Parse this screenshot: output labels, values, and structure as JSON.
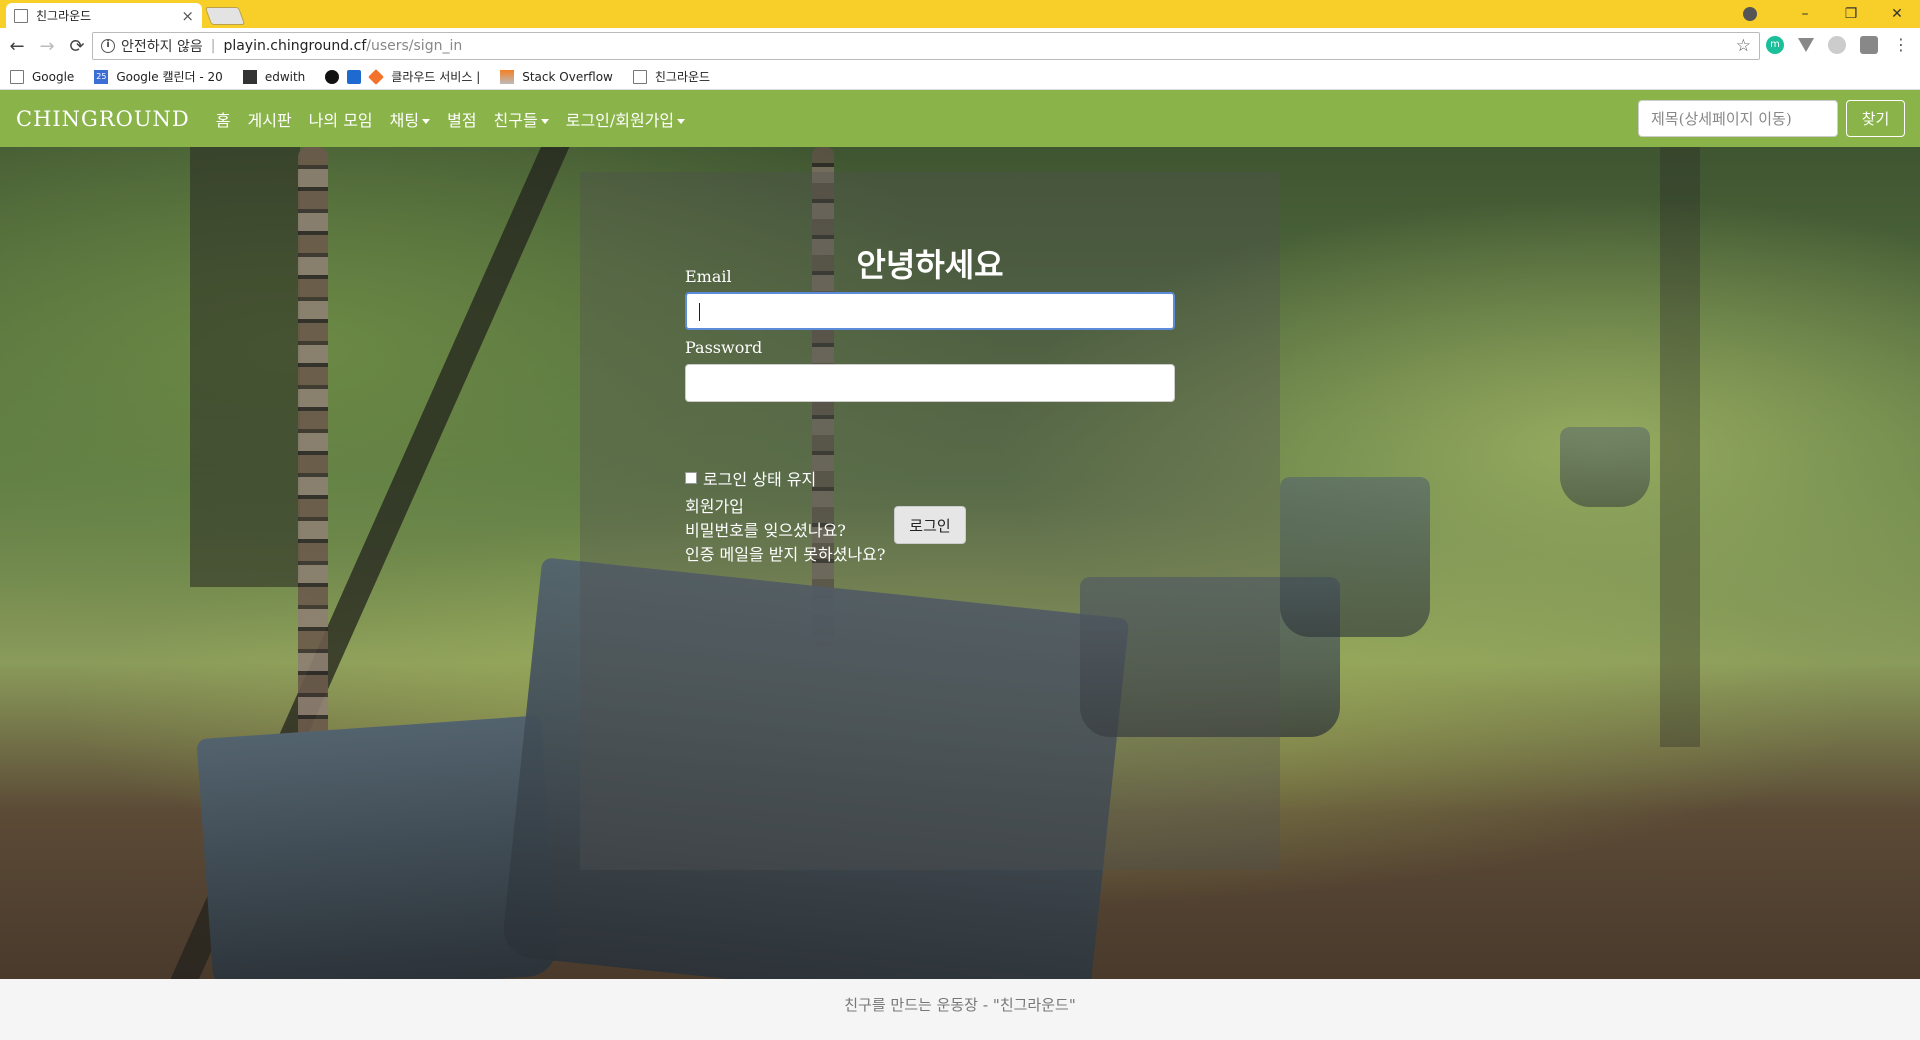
{
  "browser": {
    "tab_title": "친그라운드",
    "tab_close": "×",
    "window_controls": [
      "–",
      "❐",
      "✕"
    ],
    "nav": {
      "back": "←",
      "forward": "→",
      "reload": "⟳"
    },
    "address": {
      "security_label": "안전하지 않음",
      "host": "playin.chinground.cf",
      "path": "/users/sign_in"
    },
    "bookmark_star": "☆",
    "bookmarks": [
      {
        "label": "Google",
        "icon": "page-icon"
      },
      {
        "label": "Google 캘린더 - 20",
        "icon": "calendar-icon",
        "badge": "25"
      },
      {
        "label": "edwith",
        "icon": "edwith-icon"
      },
      {
        "label": "",
        "icon": "github-icon"
      },
      {
        "label": "",
        "icon": "blue-square-icon"
      },
      {
        "label": "클라우드 서비스 | ",
        "icon": "cube-icon"
      },
      {
        "label": "Stack Overflow",
        "icon": "stackoverflow-icon"
      },
      {
        "label": "친그라운드",
        "icon": "page-icon"
      }
    ],
    "extensions": [
      "m",
      "",
      "",
      "",
      "⋮"
    ]
  },
  "navbar": {
    "brand": "CHINGROUND",
    "items": [
      {
        "label": "홈",
        "dropdown": false
      },
      {
        "label": "게시판",
        "dropdown": false
      },
      {
        "label": "나의 모임",
        "dropdown": false
      },
      {
        "label": "채팅",
        "dropdown": true
      },
      {
        "label": "별점",
        "dropdown": false
      },
      {
        "label": "친구들",
        "dropdown": true
      },
      {
        "label": "로그인/회원가입",
        "dropdown": true
      }
    ],
    "search_placeholder": "제목(상세페이지 이동)",
    "search_button": "찾기",
    "color": "#8ab44a"
  },
  "login": {
    "greeting": "안녕하세요",
    "email_label": "Email",
    "email_value": "",
    "password_label": "Password",
    "password_value": "",
    "remember_label": "로그인 상태 유지",
    "submit_label": "로그인",
    "links": [
      "회원가입",
      "비밀번호를 잊으셨나요?",
      "인증 메일을 받지 못하셨나요?"
    ]
  },
  "footer": {
    "text": "친구를 만드는 운동장 - \"친그라운드\""
  }
}
